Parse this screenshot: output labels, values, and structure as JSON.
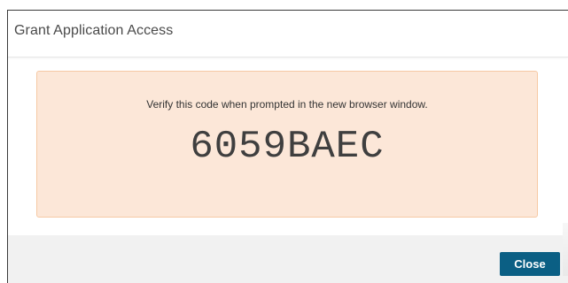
{
  "dialog": {
    "title": "Grant Application Access"
  },
  "code_panel": {
    "instruction": "Verify this code when prompted in the new browser window.",
    "code": "6059BAEC"
  },
  "footer": {
    "close_label": "Close"
  },
  "colors": {
    "panel_background": "#fce7d8",
    "panel_border": "#f6c9a4",
    "footer_background": "#f1f1f1",
    "button_background": "#0b5f84"
  }
}
